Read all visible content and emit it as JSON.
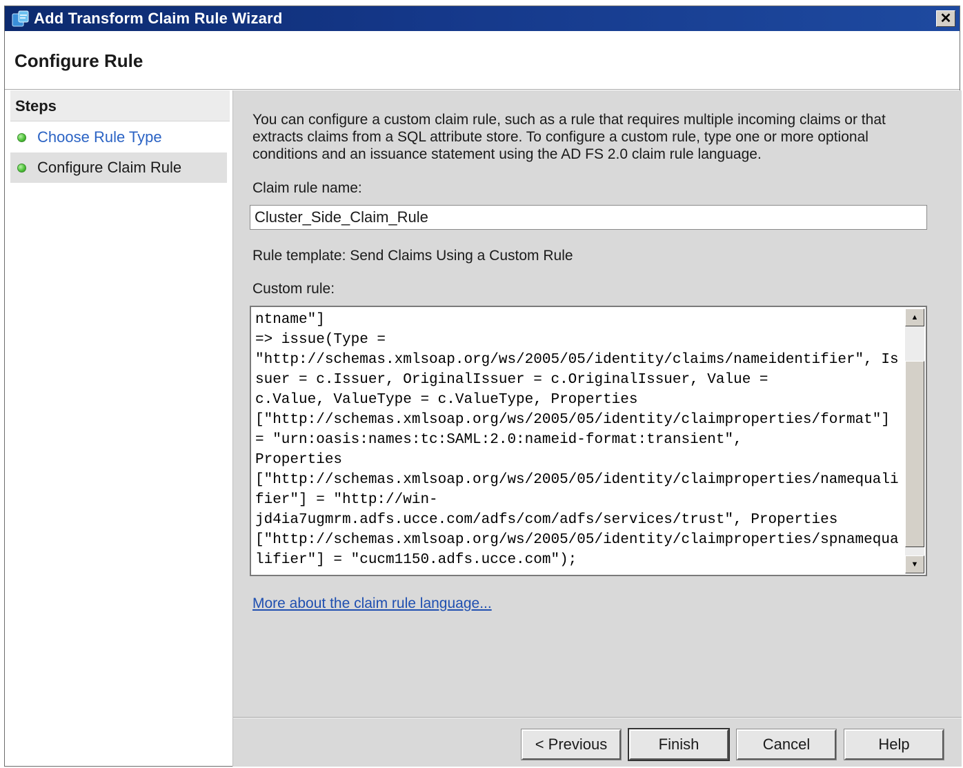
{
  "window": {
    "title": "Add Transform Claim Rule Wizard",
    "close_glyph": "✕",
    "icon": "wizard-app-icon"
  },
  "header": {
    "title": "Configure Rule"
  },
  "steps": {
    "heading": "Steps",
    "items": [
      {
        "label": "Choose Rule Type",
        "state": "completed-link"
      },
      {
        "label": "Configure Claim Rule",
        "state": "current"
      }
    ]
  },
  "main": {
    "intro": "You can configure a custom claim rule, such as a rule that requires multiple incoming claims or that extracts claims from a SQL attribute store. To configure a custom rule, type one or more optional conditions and an issuance statement using the AD FS 2.0 claim rule language.",
    "claim_rule_name_label": "Claim rule name:",
    "claim_rule_name_value": "Cluster_Side_Claim_Rule",
    "rule_template": "Rule template: Send Claims Using a Custom Rule",
    "custom_rule_label": "Custom rule:",
    "custom_rule_text": "ntname\"]\n=> issue(Type =\n\"http://schemas.xmlsoap.org/ws/2005/05/identity/claims/nameidentifier\", Issuer = c.Issuer, OriginalIssuer = c.OriginalIssuer, Value =\nc.Value, ValueType = c.ValueType, Properties\n[\"http://schemas.xmlsoap.org/ws/2005/05/identity/claimproperties/format\"] = \"urn:oasis:names:tc:SAML:2.0:nameid-format:transient\",\nProperties\n[\"http://schemas.xmlsoap.org/ws/2005/05/identity/claimproperties/namequalifier\"] = \"http://win-\njd4ia7ugmrm.adfs.ucce.com/adfs/com/adfs/services/trust\", Properties\n[\"http://schemas.xmlsoap.org/ws/2005/05/identity/claimproperties/spnamequalifier\"] = \"cucm1150.adfs.ucce.com\");",
    "more_link": "More about the claim rule language..."
  },
  "footer": {
    "previous_label": "< Previous",
    "finish_label": "Finish",
    "cancel_label": "Cancel",
    "help_label": "Help"
  },
  "colors": {
    "titlebar": "#15388a",
    "panel_bg": "#d9d9d9",
    "link": "#2b63c4",
    "step_dot": "#4fc33a"
  }
}
